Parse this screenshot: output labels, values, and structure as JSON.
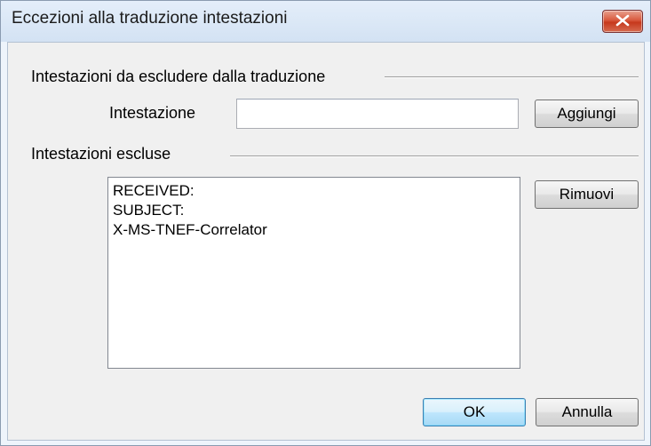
{
  "window": {
    "title": "Eccezioni alla traduzione intestazioni"
  },
  "close_icon": "close-icon",
  "exclude_group": {
    "label": "Intestazioni da escludere dalla traduzione",
    "field_label": "Intestazione",
    "field_value": "",
    "add_label": "Aggiungi"
  },
  "excluded_group": {
    "label": "Intestazioni escluse",
    "items": [
      "RECEIVED:",
      "SUBJECT:",
      "X-MS-TNEF-Correlator"
    ],
    "remove_label": "Rimuovi"
  },
  "footer": {
    "ok_label": "OK",
    "cancel_label": "Annulla"
  },
  "colors": {
    "close_button": "#c6381d",
    "client_background": "#f0f0f0",
    "title_bar": "#dbe7f5"
  }
}
